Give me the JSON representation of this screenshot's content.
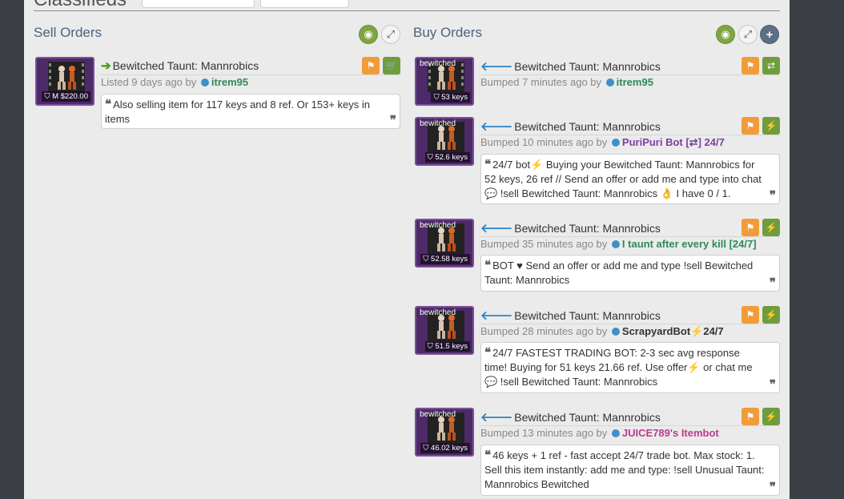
{
  "page_heading": "Classifieds",
  "sell_title": "Sell Orders",
  "buy_title": "Buy Orders",
  "icons": {
    "eye": "eye-icon",
    "expand": "expand-icon",
    "plus": "plus-icon",
    "flag": "flag-icon",
    "cart": "cart-icon",
    "swap": "swap-icon",
    "bolt": "lightning-icon",
    "tag": "tag-icon",
    "quote": "quote-icon"
  },
  "colors": {
    "sell_arrow": "#41a31d",
    "buy_arrow": "#2c83c4",
    "flag_button": "#f19c38",
    "action_button": "#6f9c3d",
    "item_quality": "#7d4f9b"
  },
  "sell": [
    {
      "name": "Bewitched Taunt: Mannrobics",
      "effect": "",
      "price": "M $220.00",
      "meta_prefix": "Listed 9 days ago by",
      "user": "itrem95",
      "user_color": "#2e8b57",
      "comment": "Also selling item for 117 keys and 8 ref. Or 153+ keys in items"
    }
  ],
  "buy": [
    {
      "name": "Bewitched Taunt: Mannrobics",
      "effect": "bewitched",
      "price": "53 keys",
      "meta_prefix": "Bumped 7 minutes ago by",
      "user": "itrem95",
      "user_color": "#2e8b57",
      "comment": ""
    },
    {
      "name": "Bewitched Taunt: Mannrobics",
      "effect": "bewitched",
      "price": "52.6 keys",
      "meta_prefix": "Bumped 10 minutes ago by",
      "user": "PuriPuri Bot [⇄] 24/7",
      "user_color": "#7b3fa0",
      "comment": "24/7 bot⚡ Buying your Bewitched Taunt: Mannrobics for 52 keys, 26 ref // Send an offer or add me and type into chat💬 !sell Bewitched Taunt: Mannrobics 👌 I have 0 / 1."
    },
    {
      "name": "Bewitched Taunt: Mannrobics",
      "effect": "bewitched",
      "price": "52.58 keys",
      "meta_prefix": "Bumped 35 minutes ago by",
      "user": "I taunt after every kill [24/7]",
      "user_color": "#2e8b57",
      "comment": "BOT ♥ Send an offer or add me and type !sell Bewitched Taunt: Mannrobics"
    },
    {
      "name": "Bewitched Taunt: Mannrobics",
      "effect": "bewitched",
      "price": "51.5 keys",
      "meta_prefix": "Bumped 28 minutes ago by",
      "user": "ScrapyardBot⚡24/7",
      "user_color": "#333333",
      "comment": "24/7 FASTEST TRADING BOT: 2-3 sec avg response time! Buying for 51 keys 21.66 ref. Use offer⚡ or chat me💬 !sell Bewitched Taunt: Mannrobics"
    },
    {
      "name": "Bewitched Taunt: Mannrobics",
      "effect": "bewitched",
      "price": "46.02 keys",
      "meta_prefix": "Bumped 13 minutes ago by",
      "user": "JUICE789's Itembot",
      "user_color": "#c0398f",
      "comment": "46 keys + 1 ref - fast accept 24/7 trade bot. Max stock: 1. Sell this item instantly: add me and type: !sell Unusual Taunt: Mannrobics Bewitched"
    }
  ]
}
